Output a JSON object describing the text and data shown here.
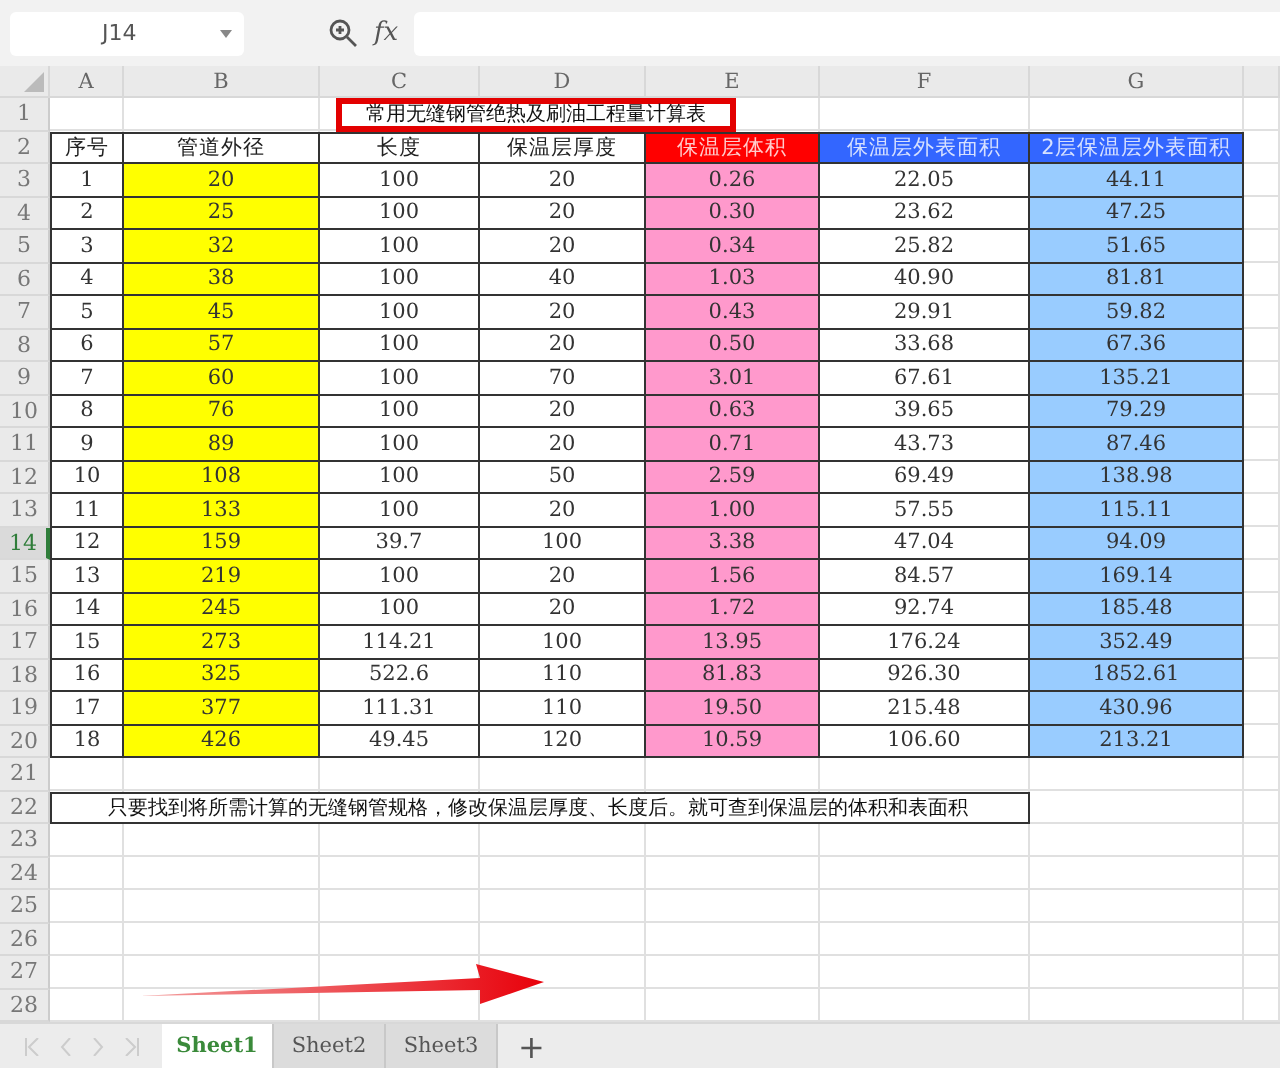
{
  "name_box": "J14",
  "formula_bar": {
    "icon": "fx"
  },
  "column_headers": [
    "A",
    "B",
    "C",
    "D",
    "E",
    "F",
    "G"
  ],
  "row_headers": [
    {
      "label": "1",
      "selected": false
    },
    {
      "label": "2",
      "selected": false
    },
    {
      "label": "3",
      "selected": false
    },
    {
      "label": "4",
      "selected": false
    },
    {
      "label": "5",
      "selected": false
    },
    {
      "label": "6",
      "selected": false
    },
    {
      "label": "7",
      "selected": false
    },
    {
      "label": "8",
      "selected": false
    },
    {
      "label": "9",
      "selected": false
    },
    {
      "label": "10",
      "selected": false
    },
    {
      "label": "11",
      "selected": false
    },
    {
      "label": "12",
      "selected": false
    },
    {
      "label": "13",
      "selected": false
    },
    {
      "label": "14",
      "selected": true
    },
    {
      "label": "15",
      "selected": false
    },
    {
      "label": "16",
      "selected": false
    },
    {
      "label": "17",
      "selected": false
    },
    {
      "label": "18",
      "selected": false
    },
    {
      "label": "19",
      "selected": false
    },
    {
      "label": "20",
      "selected": false
    },
    {
      "label": "21",
      "selected": false
    },
    {
      "label": "22",
      "selected": false
    },
    {
      "label": "23",
      "selected": false
    },
    {
      "label": "24",
      "selected": false
    },
    {
      "label": "25",
      "selected": false
    },
    {
      "label": "26",
      "selected": false
    },
    {
      "label": "27",
      "selected": false
    },
    {
      "label": "28",
      "selected": false
    }
  ],
  "table": {
    "title": "常用无缝钢管绝热及刷油工程量计算表",
    "columns": [
      {
        "heading": {
          "label": "序号",
          "color": "#ffffff"
        },
        "color": "#ffffff"
      },
      {
        "heading": {
          "label": "管道外径",
          "color": "#ffffff"
        },
        "color": "#ffff00"
      },
      {
        "heading": {
          "label": "长度",
          "color": "#ffffff"
        },
        "color": "#ffffff"
      },
      {
        "heading": {
          "label": "保温层厚度",
          "color": "#ffffff"
        },
        "color": "#ffffff"
      },
      {
        "heading": {
          "label": "保温层体积",
          "color": "#ff0000"
        },
        "color": "#ff99cc"
      },
      {
        "heading": {
          "label": "保温层外表面积",
          "color": "#3366ff"
        },
        "color": "#ffffff"
      },
      {
        "heading": {
          "label": "2层保温层外表面积",
          "color": "#3366ff"
        },
        "color": "#99ccff"
      }
    ],
    "rows": [
      [
        "1",
        "20",
        "100",
        "20",
        "0.26",
        "22.05",
        "44.11"
      ],
      [
        "2",
        "25",
        "100",
        "20",
        "0.30",
        "23.62",
        "47.25"
      ],
      [
        "3",
        "32",
        "100",
        "20",
        "0.34",
        "25.82",
        "51.65"
      ],
      [
        "4",
        "38",
        "100",
        "40",
        "1.03",
        "40.90",
        "81.81"
      ],
      [
        "5",
        "45",
        "100",
        "20",
        "0.43",
        "29.91",
        "59.82"
      ],
      [
        "6",
        "57",
        "100",
        "20",
        "0.50",
        "33.68",
        "67.36"
      ],
      [
        "7",
        "60",
        "100",
        "70",
        "3.01",
        "67.61",
        "135.21"
      ],
      [
        "8",
        "76",
        "100",
        "20",
        "0.63",
        "39.65",
        "79.29"
      ],
      [
        "9",
        "89",
        "100",
        "20",
        "0.71",
        "43.73",
        "87.46"
      ],
      [
        "10",
        "108",
        "100",
        "50",
        "2.59",
        "69.49",
        "138.98"
      ],
      [
        "11",
        "133",
        "100",
        "20",
        "1.00",
        "57.55",
        "115.11"
      ],
      [
        "12",
        "159",
        "39.7",
        "100",
        "3.38",
        "47.04",
        "94.09"
      ],
      [
        "13",
        "219",
        "100",
        "20",
        "1.56",
        "84.57",
        "169.14"
      ],
      [
        "14",
        "245",
        "100",
        "20",
        "1.72",
        "92.74",
        "185.48"
      ],
      [
        "15",
        "273",
        "114.21",
        "100",
        "13.95",
        "176.24",
        "352.49"
      ],
      [
        "16",
        "325",
        "522.6",
        "110",
        "81.83",
        "926.30",
        "1852.61"
      ],
      [
        "17",
        "377",
        "111.31",
        "110",
        "19.50",
        "215.48",
        "430.96"
      ],
      [
        "18",
        "426",
        "49.45",
        "120",
        "10.59",
        "106.60",
        "213.21"
      ]
    ]
  },
  "note": "只要找到将所需计算的无缝钢管规格，修改保温层厚度、长度后。就可查到保温层的体积和表面积",
  "sheet_tabs": [
    {
      "label": "Sheet1",
      "selected": true
    },
    {
      "label": "Sheet2",
      "selected": false
    },
    {
      "label": "Sheet3",
      "selected": false
    }
  ],
  "add_sheet": "+"
}
